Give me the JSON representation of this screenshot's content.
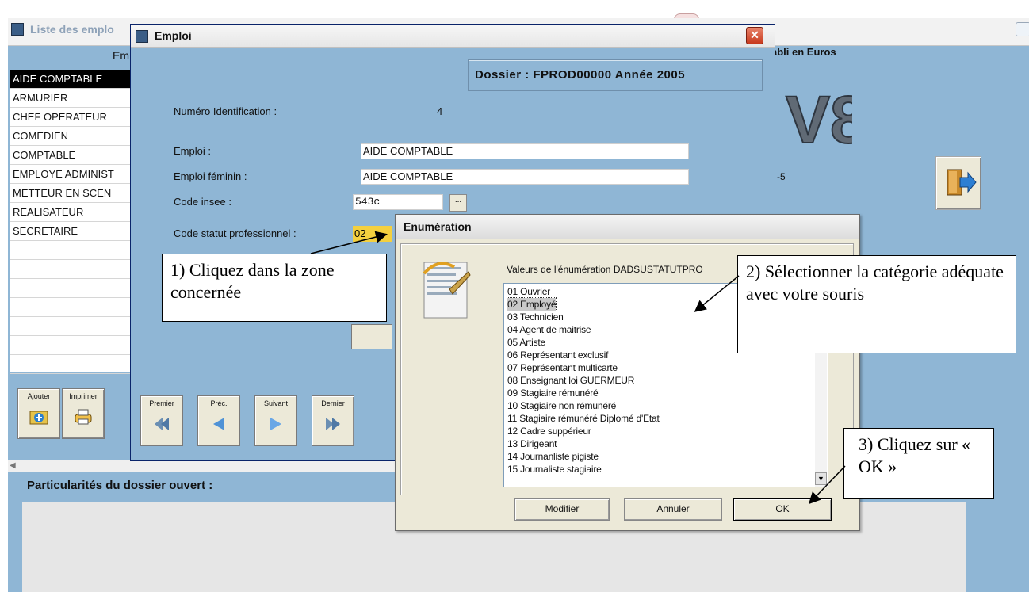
{
  "background_window": {
    "title": "Liste des emplo",
    "column_header": "Em",
    "jobs": [
      "AIDE COMPTABLE",
      "ARMURIER",
      "CHEF OPERATEUR",
      "COMEDIEN",
      "COMPTABLE",
      "EMPLOYE ADMINIST",
      "METTEUR EN SCEN",
      "REALISATEUR",
      "SECRETAIRE"
    ],
    "selected_job_index": 0,
    "etabli_label": "abli en Euros",
    "version_logo": "V8",
    "minus5": "-5",
    "toolbar": {
      "add_label": "Ajouter",
      "print_label": "Imprimer"
    },
    "particularites_label": "Particularités du dossier ouvert :"
  },
  "emploi_dialog": {
    "title": "Emploi",
    "close_glyph": "✕",
    "dossier": "Dossier  :  FPROD00000 Année 2005",
    "fields": {
      "numero_label": "Numéro Identification :",
      "numero_value": "4",
      "emploi_label": "Emploi :",
      "emploi_value": "AIDE COMPTABLE",
      "emploi_feminin_label": "Emploi  féminin :",
      "emploi_feminin_value": "AIDE COMPTABLE",
      "code_insee_label": "Code insee :",
      "code_insee_value": "543c",
      "code_statut_label": "Code statut professionnel :",
      "code_statut_value": "02"
    },
    "dots_label": "...",
    "nav": {
      "first": "Premier",
      "prev": "Préc.",
      "next": "Suivant",
      "last": "Dernier"
    }
  },
  "enum_dialog": {
    "title": "Enumération",
    "caption": "Valeurs de l'énumération DADSUSTATUTPRO",
    "options": [
      "01 Ouvrier",
      "02 Employé",
      "03 Technicien",
      "04 Agent de maitrise",
      "05 Artiste",
      "06 Représentant exclusif",
      "07 Représentant multicarte",
      "08 Enseignant loi GUERMEUR",
      "09 Stagiaire rémunéré",
      "10 Stagiaire non rémunéré",
      "11 Stagiaire rémunéré Diplomé d'Etat",
      "12 Cadre suppérieur",
      "13 Dirigeant",
      "14 Journanliste pigiste",
      "15 Journaliste stagiaire"
    ],
    "selected_index": 1,
    "buttons": {
      "modify": "Modifier",
      "cancel": "Annuler",
      "ok": "OK"
    }
  },
  "annotations": {
    "step1": "1) Cliquez dans la zone concernée",
    "step2": "2) Sélectionner la catégorie adéquate avec votre souris",
    "step3": "3) Cliquez sur « OK »"
  },
  "colors": {
    "app_background": "#8fb6d5",
    "selection": "#000000",
    "status_field": "#f4d03f",
    "dialog_face": "#ece9d8"
  }
}
